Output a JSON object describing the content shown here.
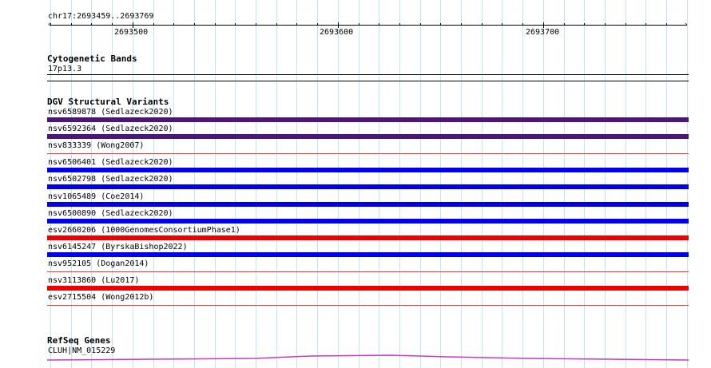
{
  "ruler": {
    "position": "chr17:2693459..2693769",
    "ticks": [
      "2693500",
      "2693600",
      "2693700"
    ]
  },
  "cytoband": {
    "title": "Cytogenetic Bands",
    "label": "17p13.3"
  },
  "dgv": {
    "title": "DGV Structural Variants",
    "items": [
      {
        "label": "nsv6589878  (Sedlazeck2020)",
        "color": "#4b1579",
        "style": "thick"
      },
      {
        "label": "nsv6592364  (Sedlazeck2020)",
        "color": "#4b1579",
        "style": "thick"
      },
      {
        "label": "nsv833339  (Wong2007)",
        "color": "#e23b3b",
        "style": "thin"
      },
      {
        "label": "nsv6506401  (Sedlazeck2020)",
        "color": "#0000ee",
        "style": "thick"
      },
      {
        "label": "nsv6502798  (Sedlazeck2020)",
        "color": "#0000ee",
        "style": "thick"
      },
      {
        "label": "nsv1065489  (Coe2014)",
        "color": "#0000ee",
        "style": "thick"
      },
      {
        "label": "nsv6500890  (Sedlazeck2020)",
        "color": "#0000ee",
        "style": "thick"
      },
      {
        "label": "esv2660206  (1000GenomesConsortiumPhase1)",
        "color": "#ee0000",
        "style": "thick"
      },
      {
        "label": "nsv6145247  (ByrskaBishop2022)",
        "color": "#0000ee",
        "style": "thick"
      },
      {
        "label": "nsv952105  (Dogan2014)",
        "color": "#e23b3b",
        "style": "thin"
      },
      {
        "label": "nsv3113860  (Lu2017)",
        "color": "#ee0000",
        "style": "thick"
      },
      {
        "label": "esv2715504  (Wong2012b)",
        "color": "#e23b3b",
        "style": "thin"
      }
    ]
  },
  "refseq": {
    "title": "RefSeq Genes",
    "label": "CLUH|NM_015229",
    "color": "#c837c8"
  }
}
